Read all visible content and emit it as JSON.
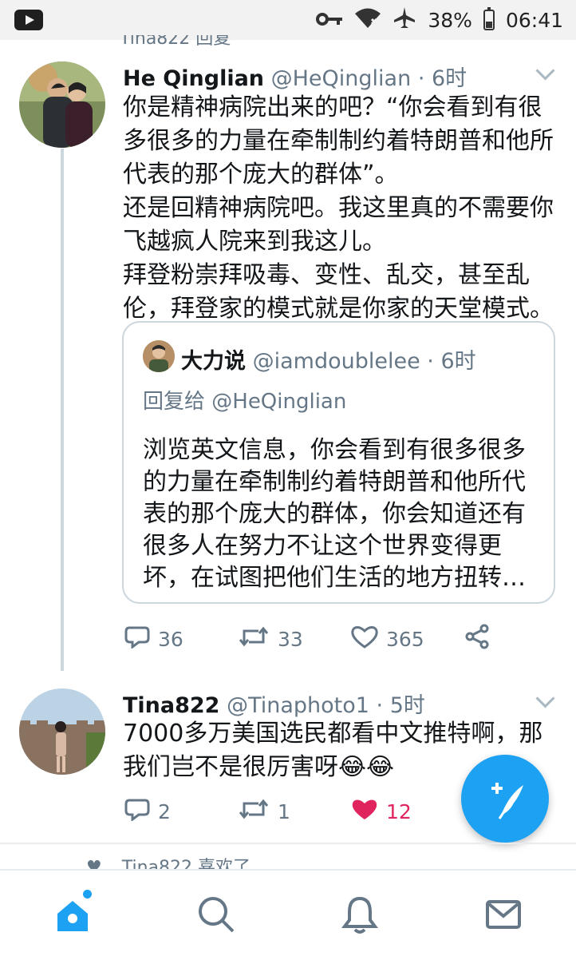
{
  "status_bar": {
    "battery": "38%",
    "time": "06:41",
    "icons": [
      "youtube-icon",
      "vpn-key-icon",
      "wifi-icon",
      "airplane-mode-icon",
      "battery-icon"
    ],
    "battery_level": 0.38
  },
  "top_clipped": "Tina822 回复",
  "tweet1": {
    "name": "He Qinglian",
    "handle": "@HeQinglian",
    "time": "· 6时",
    "paragraphs": [
      "你是精神病院出来的吧？“你会看到有很\n多很多的力量在牵制制约着特朗普和他所\n代表的那个庞大的群体”。",
      "还是回精神病院吧。我这里真的不需要你\n飞越疯人院来到我这儿。",
      "拜登粉崇拜吸毒、变性、乱交，甚至乱\n伦，拜登家的模式就是你家的天堂模式。"
    ],
    "quote": {
      "name": "大力说",
      "handle": "@iamdoublelee",
      "time": "· 6时",
      "reply_to": "回复给 @HeQinglian",
      "text": "浏览英文信息，你会看到有很多很多\n的力量在牵制制约着特朗普和他所代\n表的那个庞大的群体，你会知道还有\n很多人在努力不让这个世界变得更\n坏，在试图把他们生活的地方扭转…"
    },
    "replies": "36",
    "retweets": "33",
    "likes": "365"
  },
  "tweet2": {
    "name": "Tina822",
    "handle": "@Tinaphoto1",
    "time": "· 5时",
    "text": "7000多万美国选民都看中文推特啊，那\n我们岂不是很厉害呀😂😂",
    "replies": "2",
    "retweets": "1",
    "likes": "12",
    "liked": true
  },
  "bottom_clipped": "Tina822 喜欢了",
  "colors": {
    "accent": "#1da1f2",
    "like": "#e0245e",
    "secondary_text": "#657786",
    "border": "#ccd6dd"
  },
  "nav_icons": [
    "home-icon",
    "search-icon",
    "notifications-icon",
    "messages-icon"
  ]
}
